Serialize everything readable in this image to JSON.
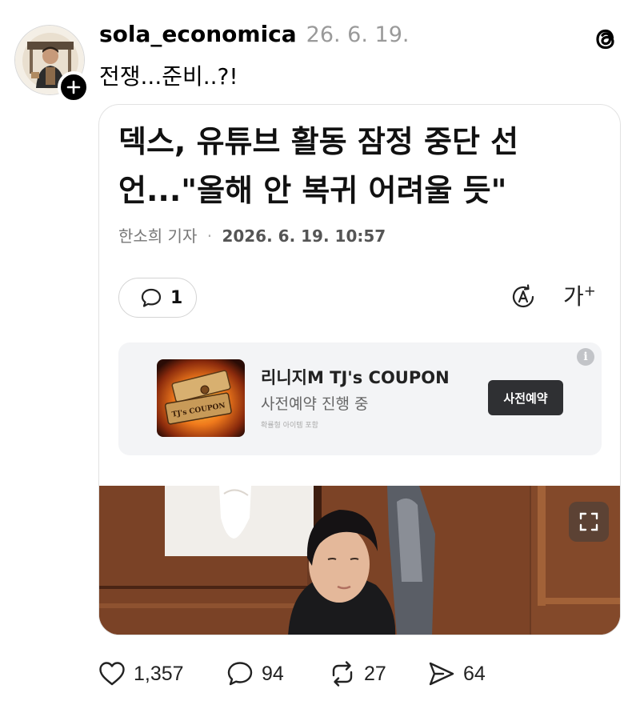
{
  "post": {
    "username": "sola_economica",
    "date": "26. 6. 19.",
    "text": "전쟁...준비..?!"
  },
  "article": {
    "headline": "덱스, 유튜브 활동 잠정 중단 선언...\"올해 안 복귀 어려울 듯\"",
    "reporter": "한소희 기자",
    "separator": "·",
    "published": "2026. 6. 19. 10:57",
    "comment_count": "1",
    "font_size_label": "가",
    "font_size_sup": "+"
  },
  "ad": {
    "title": "리니지M TJ's COUPON",
    "subtitle": "사전예약 진행 중",
    "note": "확률형 아이템 포함",
    "cta": "사전예약",
    "info": "i",
    "image_text": "TJ's COUPON"
  },
  "actions": {
    "likes": "1,357",
    "comments": "94",
    "reposts": "27",
    "shares": "64"
  },
  "icons": [
    "avatar",
    "plus-icon",
    "threads-logo-icon",
    "speech-bubble-icon",
    "tts-icon",
    "font-size-icon",
    "info-icon",
    "fullscreen-icon",
    "heart-icon",
    "comment-icon",
    "repost-icon",
    "share-icon"
  ],
  "colors": {
    "cta_bg": "#2f3033",
    "date_gray": "#9a9a9a",
    "ad_bg": "#f3f4f6"
  }
}
